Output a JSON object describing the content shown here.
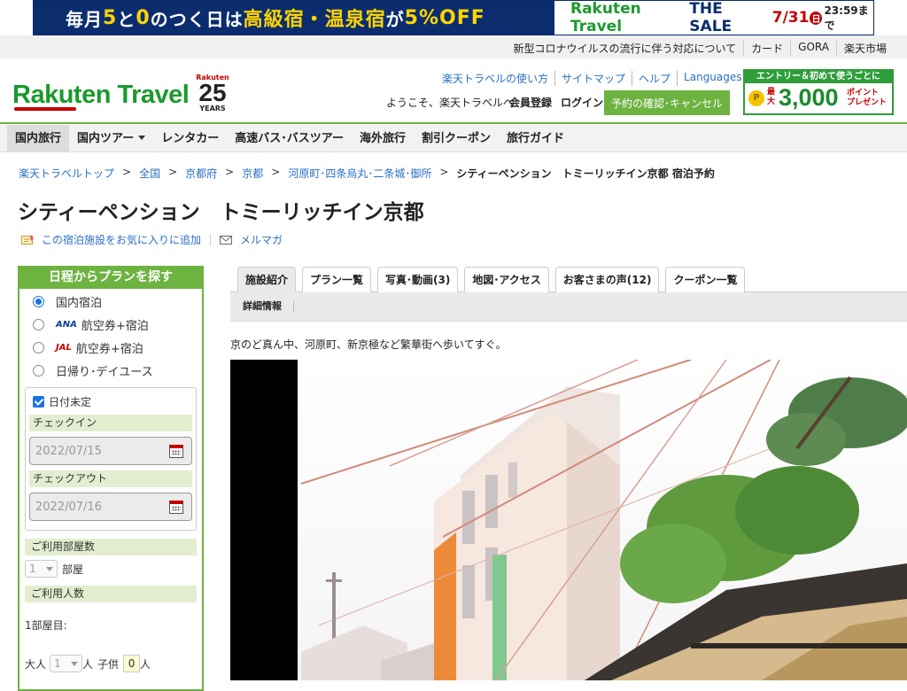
{
  "banner": {
    "left_parts": [
      "毎月",
      "5",
      "と",
      "0",
      "のつく日は",
      "高級宿・温泉宿",
      "が",
      "5",
      "%OFF"
    ],
    "brand": "Rakuten Travel",
    "sale": "THE SALE",
    "date": "7/31",
    "weekday": "日",
    "time": "23:59まで"
  },
  "utility_links": [
    "新型コロナウイルスの流行に伴う対応について",
    "カード",
    "GORA",
    "楽天市場"
  ],
  "header": {
    "logo": "Rakuten Travel",
    "anniv_brand": "Rakuten",
    "anniv_num": "25",
    "anniv_years": "YEARS",
    "links": [
      "楽天トラベルの使い方",
      "サイトマップ",
      "ヘルプ",
      "Languages"
    ],
    "welcome": "ようこそ、楽天トラベルへ",
    "member": "会員登録",
    "login": "ログイン",
    "reserve": "予約の確認･キャンセル",
    "promo_top": "エントリー＆初めて使うごとに",
    "promo_coin": "P",
    "promo_max": "最大",
    "promo_amount": "3,000",
    "promo_points": "ポイント",
    "promo_present": "プレゼント"
  },
  "nav": [
    "国内旅行",
    "国内ツアー",
    "レンタカー",
    "高速バス･バスツアー",
    "海外旅行",
    "割引クーポン",
    "旅行ガイド"
  ],
  "breadcrumb": {
    "items": [
      "楽天トラベルトップ",
      "全国",
      "京都府",
      "京都",
      "河原町･四条烏丸･二条城･御所"
    ],
    "separator": ">",
    "current": "シティーペンション　トミーリッチイン京都 宿泊予約"
  },
  "title": "シティーペンション　トミーリッチイン京都",
  "actions": {
    "favorite": "この宿泊施設をお気に入りに追加",
    "mailmag": "メルマガ"
  },
  "sidebar": {
    "heading": "日程からプランを探す",
    "options": [
      {
        "label": "国内宿泊",
        "selected": true,
        "logo": ""
      },
      {
        "label": "航空券+宿泊",
        "selected": false,
        "logo": "ANA"
      },
      {
        "label": "航空券+宿泊",
        "selected": false,
        "logo": "JAL"
      },
      {
        "label": "日帰り･デイユース",
        "selected": false,
        "logo": ""
      }
    ],
    "undecided": "日付未定",
    "checkin_label": "チェックイン",
    "checkin_value": "2022/07/15",
    "checkout_label": "チェックアウト",
    "checkout_value": "2022/07/16",
    "rooms_label": "ご利用部屋数",
    "rooms_value": "1",
    "rooms_unit": "部屋",
    "guests_label": "ご利用人数",
    "room1": "1部屋目:",
    "adult_label": "大人",
    "adult_value": "1",
    "person_unit": "人",
    "child_label": "子供",
    "child_value": "0"
  },
  "tabs": [
    "施設紹介",
    "プラン一覧",
    "写真･動画(3)",
    "地図･アクセス",
    "お客さまの声(12)",
    "クーポン一覧"
  ],
  "subtab": "詳細情報",
  "description": "京のど真ん中、河原町、新京極など繁華街へ歩いてすぐ。",
  "colors": {
    "green": "#6cb33f",
    "link": "#2a6fc6",
    "brand_navy": "#0b2d6e",
    "brand_red": "#c40000"
  }
}
